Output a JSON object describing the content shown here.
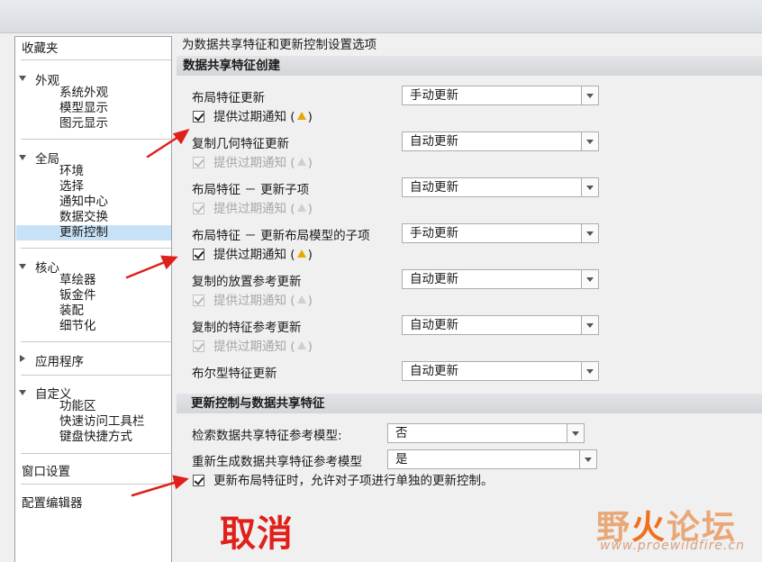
{
  "sidebar": {
    "favorites": "收藏夹",
    "groups": [
      {
        "label": "外观",
        "items": [
          "系统外观",
          "模型显示",
          "图元显示"
        ]
      },
      {
        "label": "全局",
        "items": [
          "环境",
          "选择",
          "通知中心",
          "数据交换",
          "更新控制"
        ]
      },
      {
        "label": "核心",
        "items": [
          "草绘器",
          "钣金件",
          "装配",
          "细节化"
        ]
      },
      {
        "label": "应用程序"
      },
      {
        "label": "自定义",
        "items": [
          "功能区",
          "快速访问工具栏",
          "键盘快捷方式"
        ]
      }
    ],
    "window_settings": "窗口设置",
    "config_editor": "配置编辑器"
  },
  "description": "为数据共享特征和更新控制设置选项",
  "section1": {
    "title": "数据共享特征创建",
    "rows": [
      {
        "label": "布局特征更新",
        "value": "手动更新",
        "notify": "提供过期通知 (",
        "notify_end": ")",
        "notify_enabled": true
      },
      {
        "label": "复制几何特征更新",
        "value": "自动更新",
        "notify": "提供过期通知 (",
        "notify_end": ")",
        "notify_enabled": false
      },
      {
        "label": "布局特征 － 更新子项",
        "value": "自动更新",
        "notify": "提供过期通知 (",
        "notify_end": ")",
        "notify_enabled": false
      },
      {
        "label": "布局特征 － 更新布局模型的子项",
        "value": "手动更新",
        "notify": "提供过期通知 (",
        "notify_end": ")",
        "notify_enabled": true
      },
      {
        "label": "复制的放置参考更新",
        "value": "自动更新",
        "notify": "提供过期通知 (",
        "notify_end": ")",
        "notify_enabled": false
      },
      {
        "label": "复制的特征参考更新",
        "value": "自动更新",
        "notify": "提供过期通知 (",
        "notify_end": ")",
        "notify_enabled": false
      },
      {
        "label": "布尔型特征更新",
        "value": "自动更新"
      }
    ]
  },
  "section2": {
    "title": "更新控制与数据共享特征",
    "search_label": "检索数据共享特征参考模型:",
    "search_value": "否",
    "regen_label": "重新生成数据共享特征参考模型",
    "regen_value": "是",
    "allow_label": "更新布局特征时，允许对子项进行单独的更新控制。"
  },
  "annotation": "取消",
  "watermark": {
    "title_a": "野",
    "title_b": "火",
    "title_c": "论坛",
    "url": "www.proewildfire.cn"
  },
  "colors": {
    "annotation": "#e0201a",
    "selected": "#c7e2f7",
    "warning": "#e9a800"
  }
}
